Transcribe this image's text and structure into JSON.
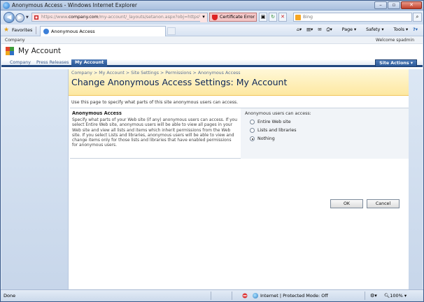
{
  "window": {
    "title": "Anonymous Access - Windows Internet Explorer"
  },
  "address": {
    "url_prefix": "https://www.",
    "url_domain": "company.com",
    "url_rest": "/my-account/_layouts/setanon.aspx?obj=https%",
    "cert_error": "Certificate Error"
  },
  "search": {
    "placeholder": "Bing"
  },
  "favorites": {
    "label": "Favorites"
  },
  "tab": {
    "label": "Anonymous Access"
  },
  "commands": {
    "page": "Page",
    "safety": "Safety",
    "tools": "Tools"
  },
  "sp": {
    "top_company": "Company",
    "welcome": "Welcome spadmin",
    "site_title": "My Account",
    "nav": [
      "Company",
      "Press Releases",
      "My Account"
    ],
    "site_actions": "Site Actions"
  },
  "page": {
    "breadcrumb": "Company > My Account > Site Settings > Permissions > Anonymous Access",
    "title": "Change Anonymous Access Settings: My Account",
    "intro": "Use this page to specify what parts of this site anonymous users can access.",
    "section_heading": "Anonymous Access",
    "section_description": "Specify what parts of your Web site (if any) anonymous users can access. If you select Entire Web site, anonymous users will be able to view all pages in your Web site and view all lists and items which inherit permissions from the Web site. If you select Lists and libraries, anonymous users will be able to view and change items only for those lists and libraries that have enabled permissions for anonymous users.",
    "options_label": "Anonymous users can access:",
    "options": [
      "Entire Web site",
      "Lists and libraries",
      "Nothing"
    ],
    "selected_option": "Nothing",
    "ok_label": "OK",
    "cancel_label": "Cancel"
  },
  "status": {
    "done": "Done",
    "zone": "Internet | Protected Mode: Off",
    "zoom": "100%"
  },
  "colors": {
    "title_gradient_top": "#fff8d8",
    "title_gradient_bottom": "#fde8a1",
    "nav_active": "#25528f",
    "page_title": "#0c2556"
  }
}
